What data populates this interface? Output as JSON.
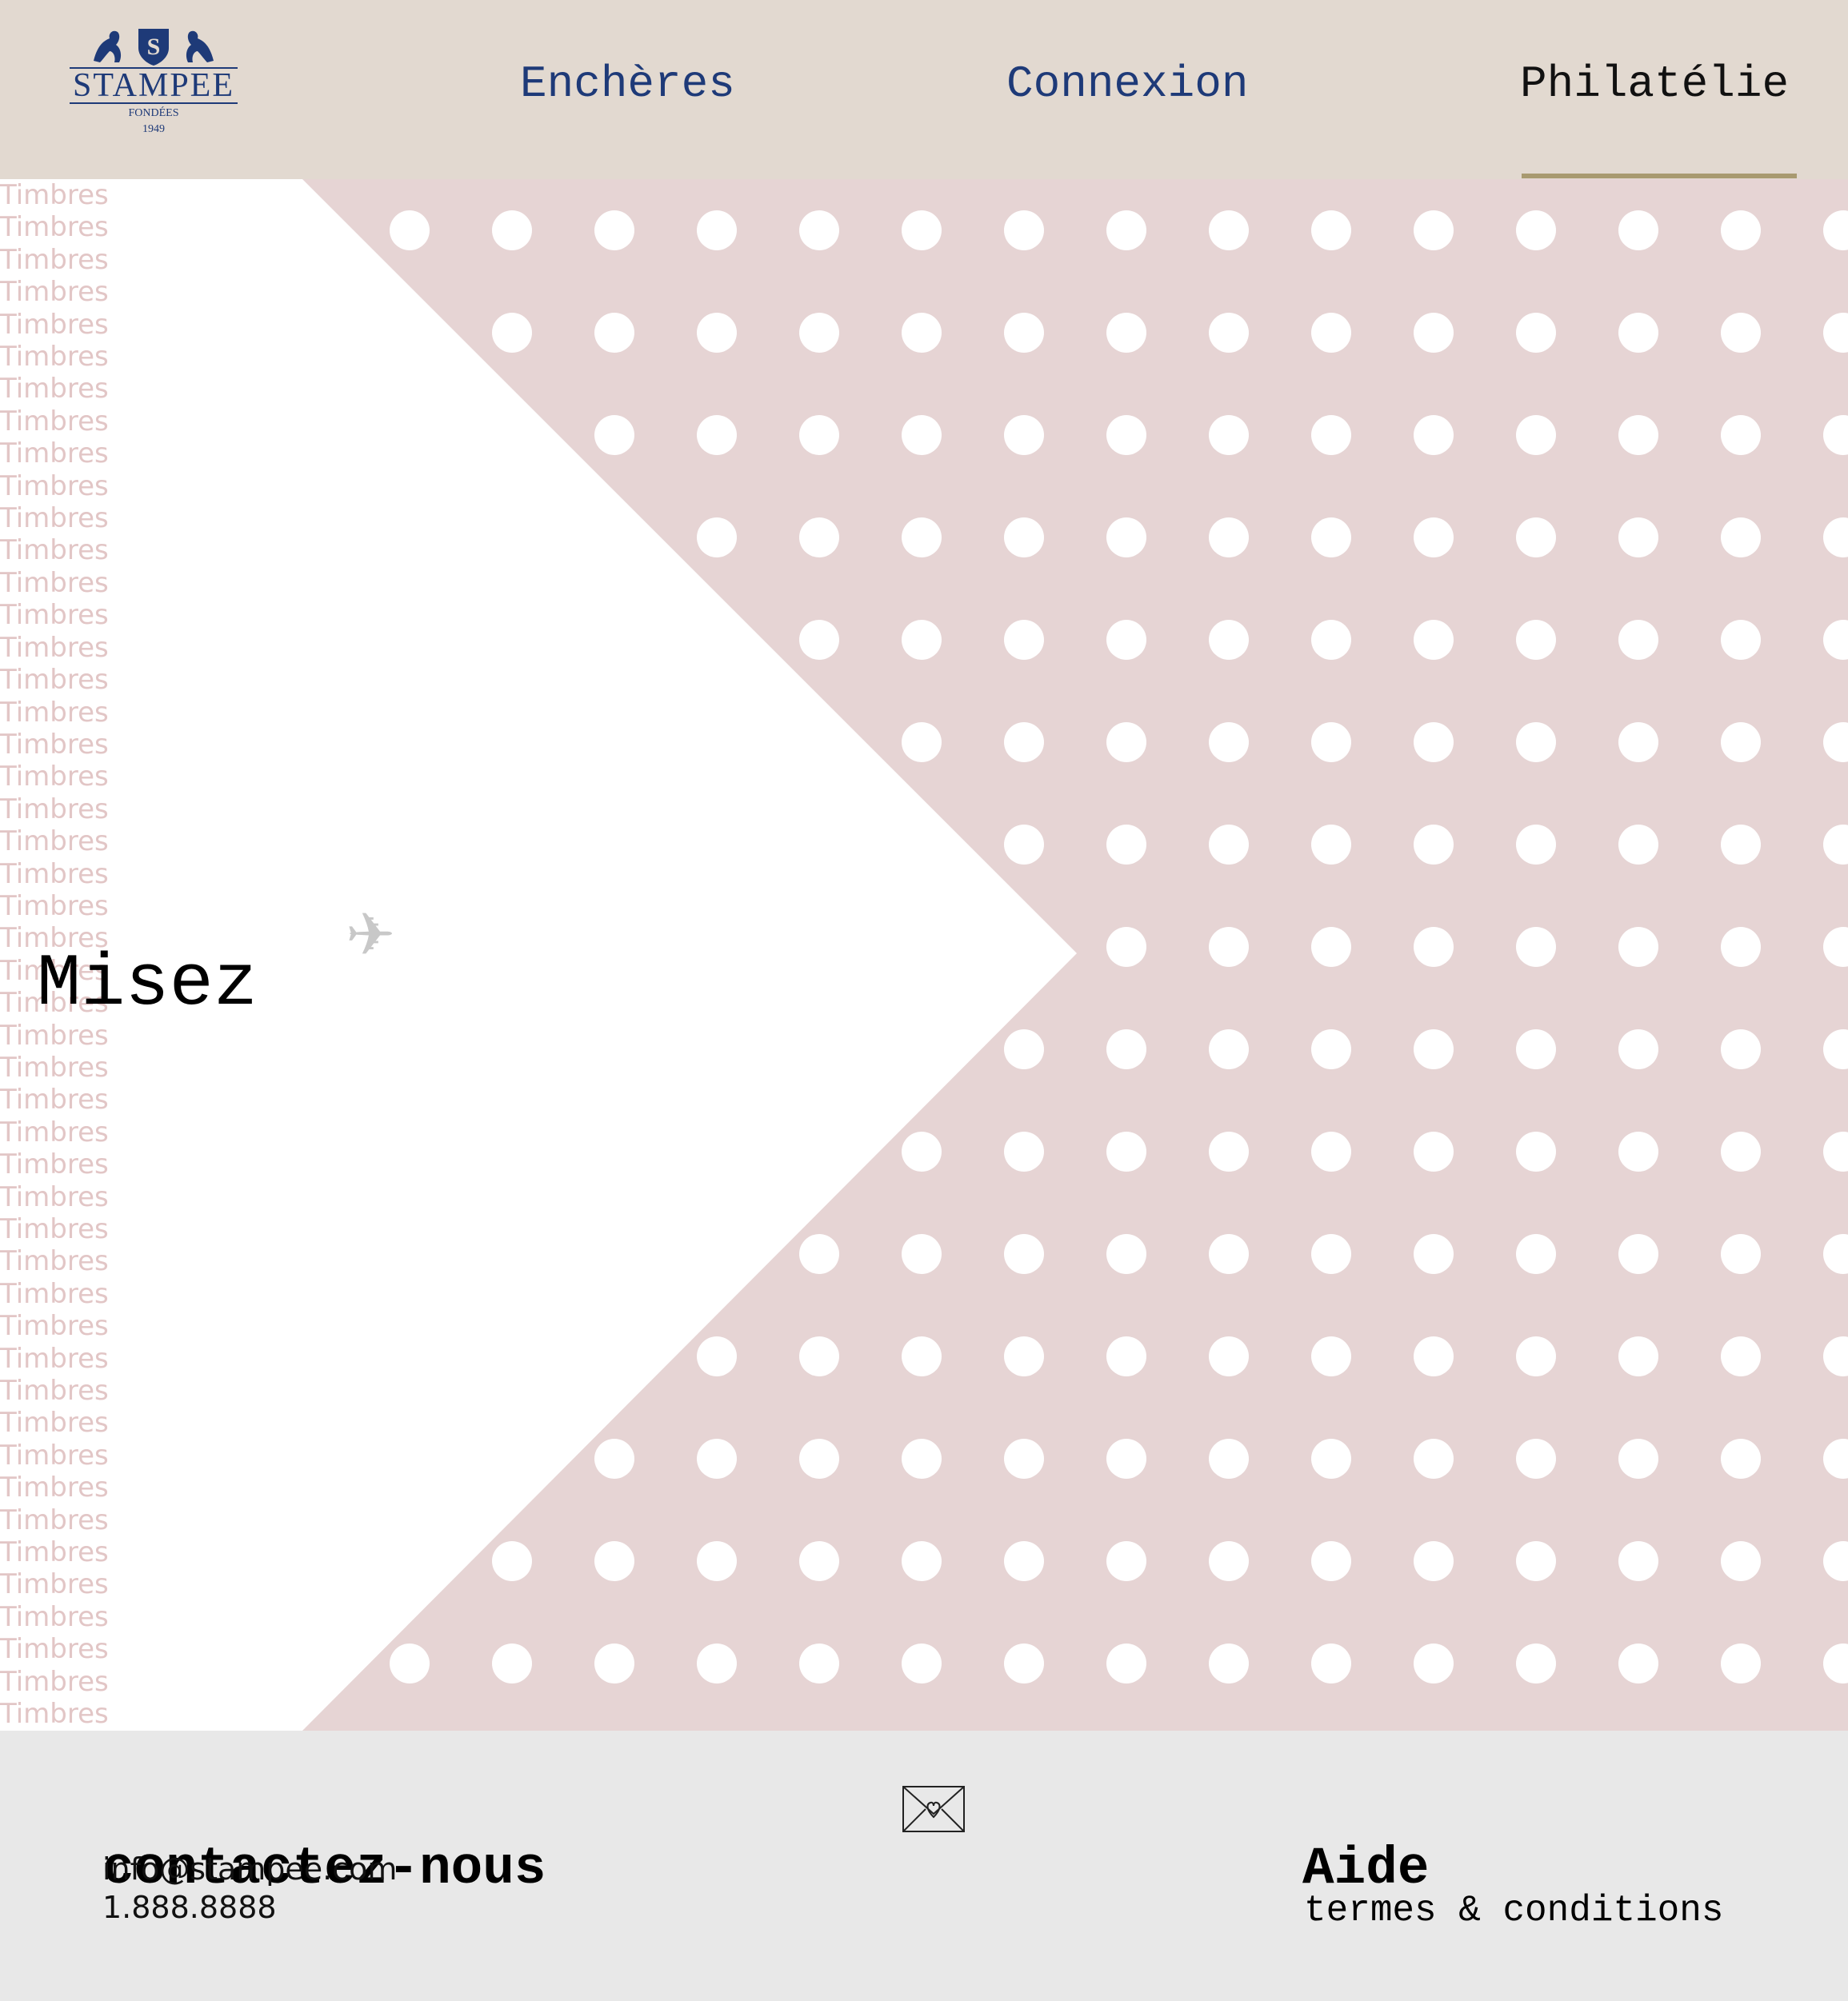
{
  "header": {
    "logo": {
      "name": "STAMPEE",
      "tagline": "FONDÉES",
      "year": "1949",
      "emblem_icon": "lion-crest-icon",
      "color": "#1e3a78"
    },
    "nav": [
      {
        "label": "Enchères"
      },
      {
        "label": "Connexion"
      },
      {
        "label": "Philatélie",
        "active": true
      }
    ],
    "accent_color": "#a89a70"
  },
  "hero": {
    "headline": "Misez",
    "plane_icon": "airplane-icon",
    "background_color": "#e6d4d4",
    "side_word": "Timbres",
    "side_word_repeat": 48
  },
  "footer": {
    "contact_title": "contactez-nous",
    "email": "info@stampee.com",
    "phone": "1.888.8888",
    "mail_icon": "envelope-heart-icon",
    "help_title": "Aide",
    "terms_link": "termes & conditions"
  }
}
